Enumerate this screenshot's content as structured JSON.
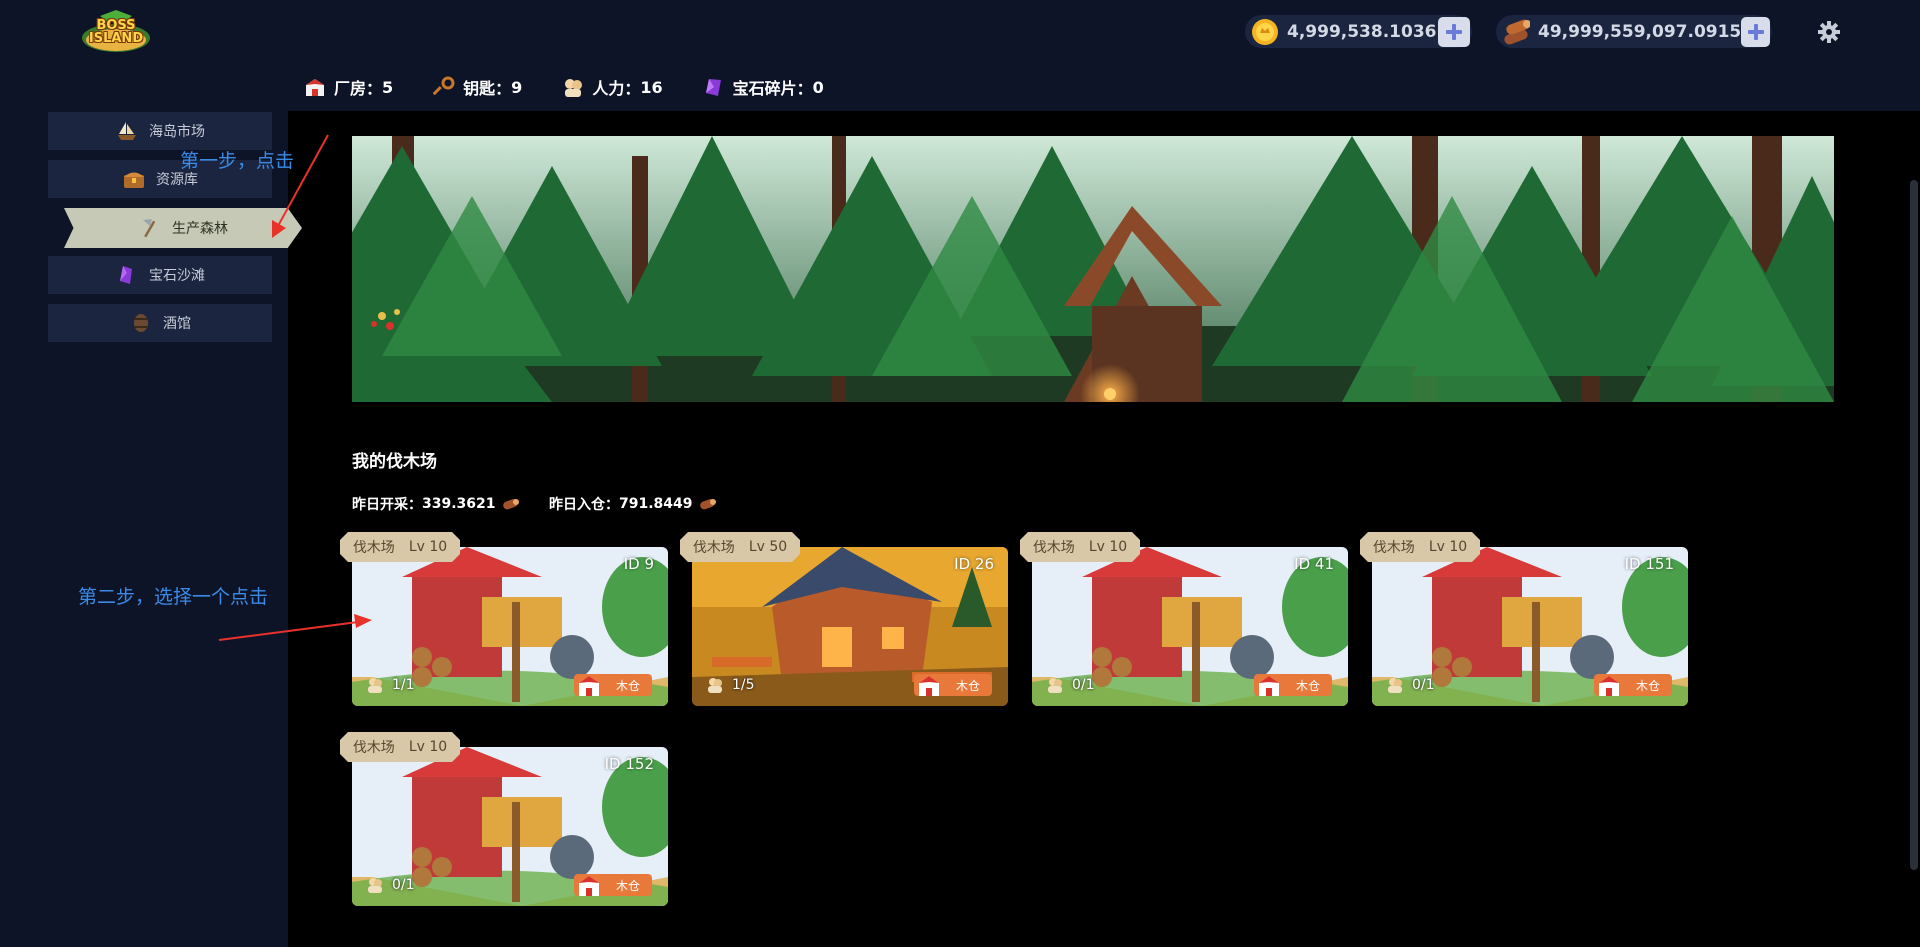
{
  "header": {
    "logo_text_1": "BOSS",
    "logo_text_2": "ISLAND",
    "coin_value": "4,999,538.1036",
    "wood_value": "49,999,559,097.0915",
    "coin_icon": "gold-coin-icon",
    "wood_icon": "wood-logs-icon",
    "add_icon": "plus-icon",
    "settings_icon": "gear-icon"
  },
  "stats": [
    {
      "label": "厂房：",
      "value": "5",
      "icon": "factory-icon"
    },
    {
      "label": "钥匙：",
      "value": "9",
      "icon": "key-icon"
    },
    {
      "label": "人力：",
      "value": "16",
      "icon": "worker-icon"
    },
    {
      "label": "宝石碎片：",
      "value": "0",
      "icon": "gem-shard-icon"
    }
  ],
  "sidebar": {
    "items": [
      {
        "label": "海岛市场",
        "icon": "ship-icon"
      },
      {
        "label": "资源库",
        "icon": "treasure-chest-icon"
      },
      {
        "label": "生产森林",
        "icon": "axe-icon",
        "active": true
      },
      {
        "label": "宝石沙滩",
        "icon": "gem-icon"
      },
      {
        "label": "酒馆",
        "icon": "barrel-icon"
      }
    ]
  },
  "main": {
    "section_title": "我的伐木场",
    "yesterday_mined_label": "昨日开采：",
    "yesterday_mined_value": "339.3621",
    "yesterday_stored_label": "昨日入仓：",
    "yesterday_stored_value": "791.8449"
  },
  "cards": [
    {
      "name": "伐木场",
      "level": "Lv 10",
      "id": "ID 9",
      "workers": "1/1",
      "button": "木仓"
    },
    {
      "name": "伐木场",
      "level": "Lv 50",
      "id": "ID 26",
      "workers": "1/5",
      "button": "木仓"
    },
    {
      "name": "伐木场",
      "level": "Lv 10",
      "id": "ID 41",
      "workers": "0/1",
      "button": "木仓"
    },
    {
      "name": "伐木场",
      "level": "Lv 10",
      "id": "ID 151",
      "workers": "0/1",
      "button": "木仓"
    },
    {
      "name": "伐木场",
      "level": "Lv 10",
      "id": "ID 152",
      "workers": "0/1",
      "button": "木仓"
    }
  ],
  "annotations": {
    "step1": "第一步，点击",
    "step2": "第二步，选择一个点击",
    "color": "#3a8ae6",
    "arrow_color": "#e8322a"
  },
  "colors": {
    "topbar_bg": "#0d1428",
    "nav_bg": "#1b2540",
    "nav_active_bg": "#c6c9b5",
    "card_tag_bg": "#d8c8a8",
    "card_button_bg": "#e8793a"
  }
}
